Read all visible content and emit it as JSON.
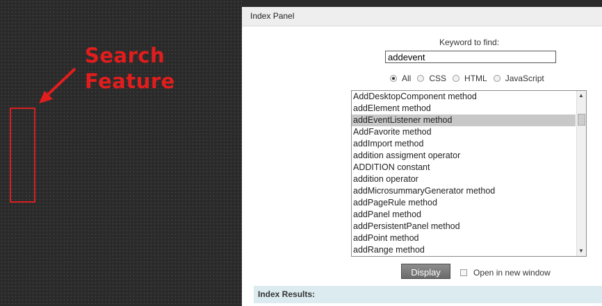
{
  "annotation": {
    "line1": "Search",
    "line2": "Feature",
    "color": "#e21d1d"
  },
  "panel": {
    "title": "Index Panel",
    "keyword_label": "Keyword to find:",
    "keyword_value": "addevent",
    "filters": [
      {
        "label": "All",
        "checked": true
      },
      {
        "label": "CSS",
        "checked": false
      },
      {
        "label": "HTML",
        "checked": false
      },
      {
        "label": "JavaScript",
        "checked": false
      }
    ],
    "list_items": [
      "AddDesktopComponent method",
      "addElement method",
      "addEventListener method",
      "AddFavorite method",
      "addImport method",
      "addition assigment operator",
      "ADDITION constant",
      "addition operator",
      "addMicrosummaryGenerator method",
      "addPageRule method",
      "addPanel method",
      "addPersistentPanel method",
      "addPoint method",
      "addRange method"
    ],
    "selected_index": 2,
    "display_label": "Display",
    "new_window_label": "Open in new window",
    "results_label": "Index Results:"
  }
}
